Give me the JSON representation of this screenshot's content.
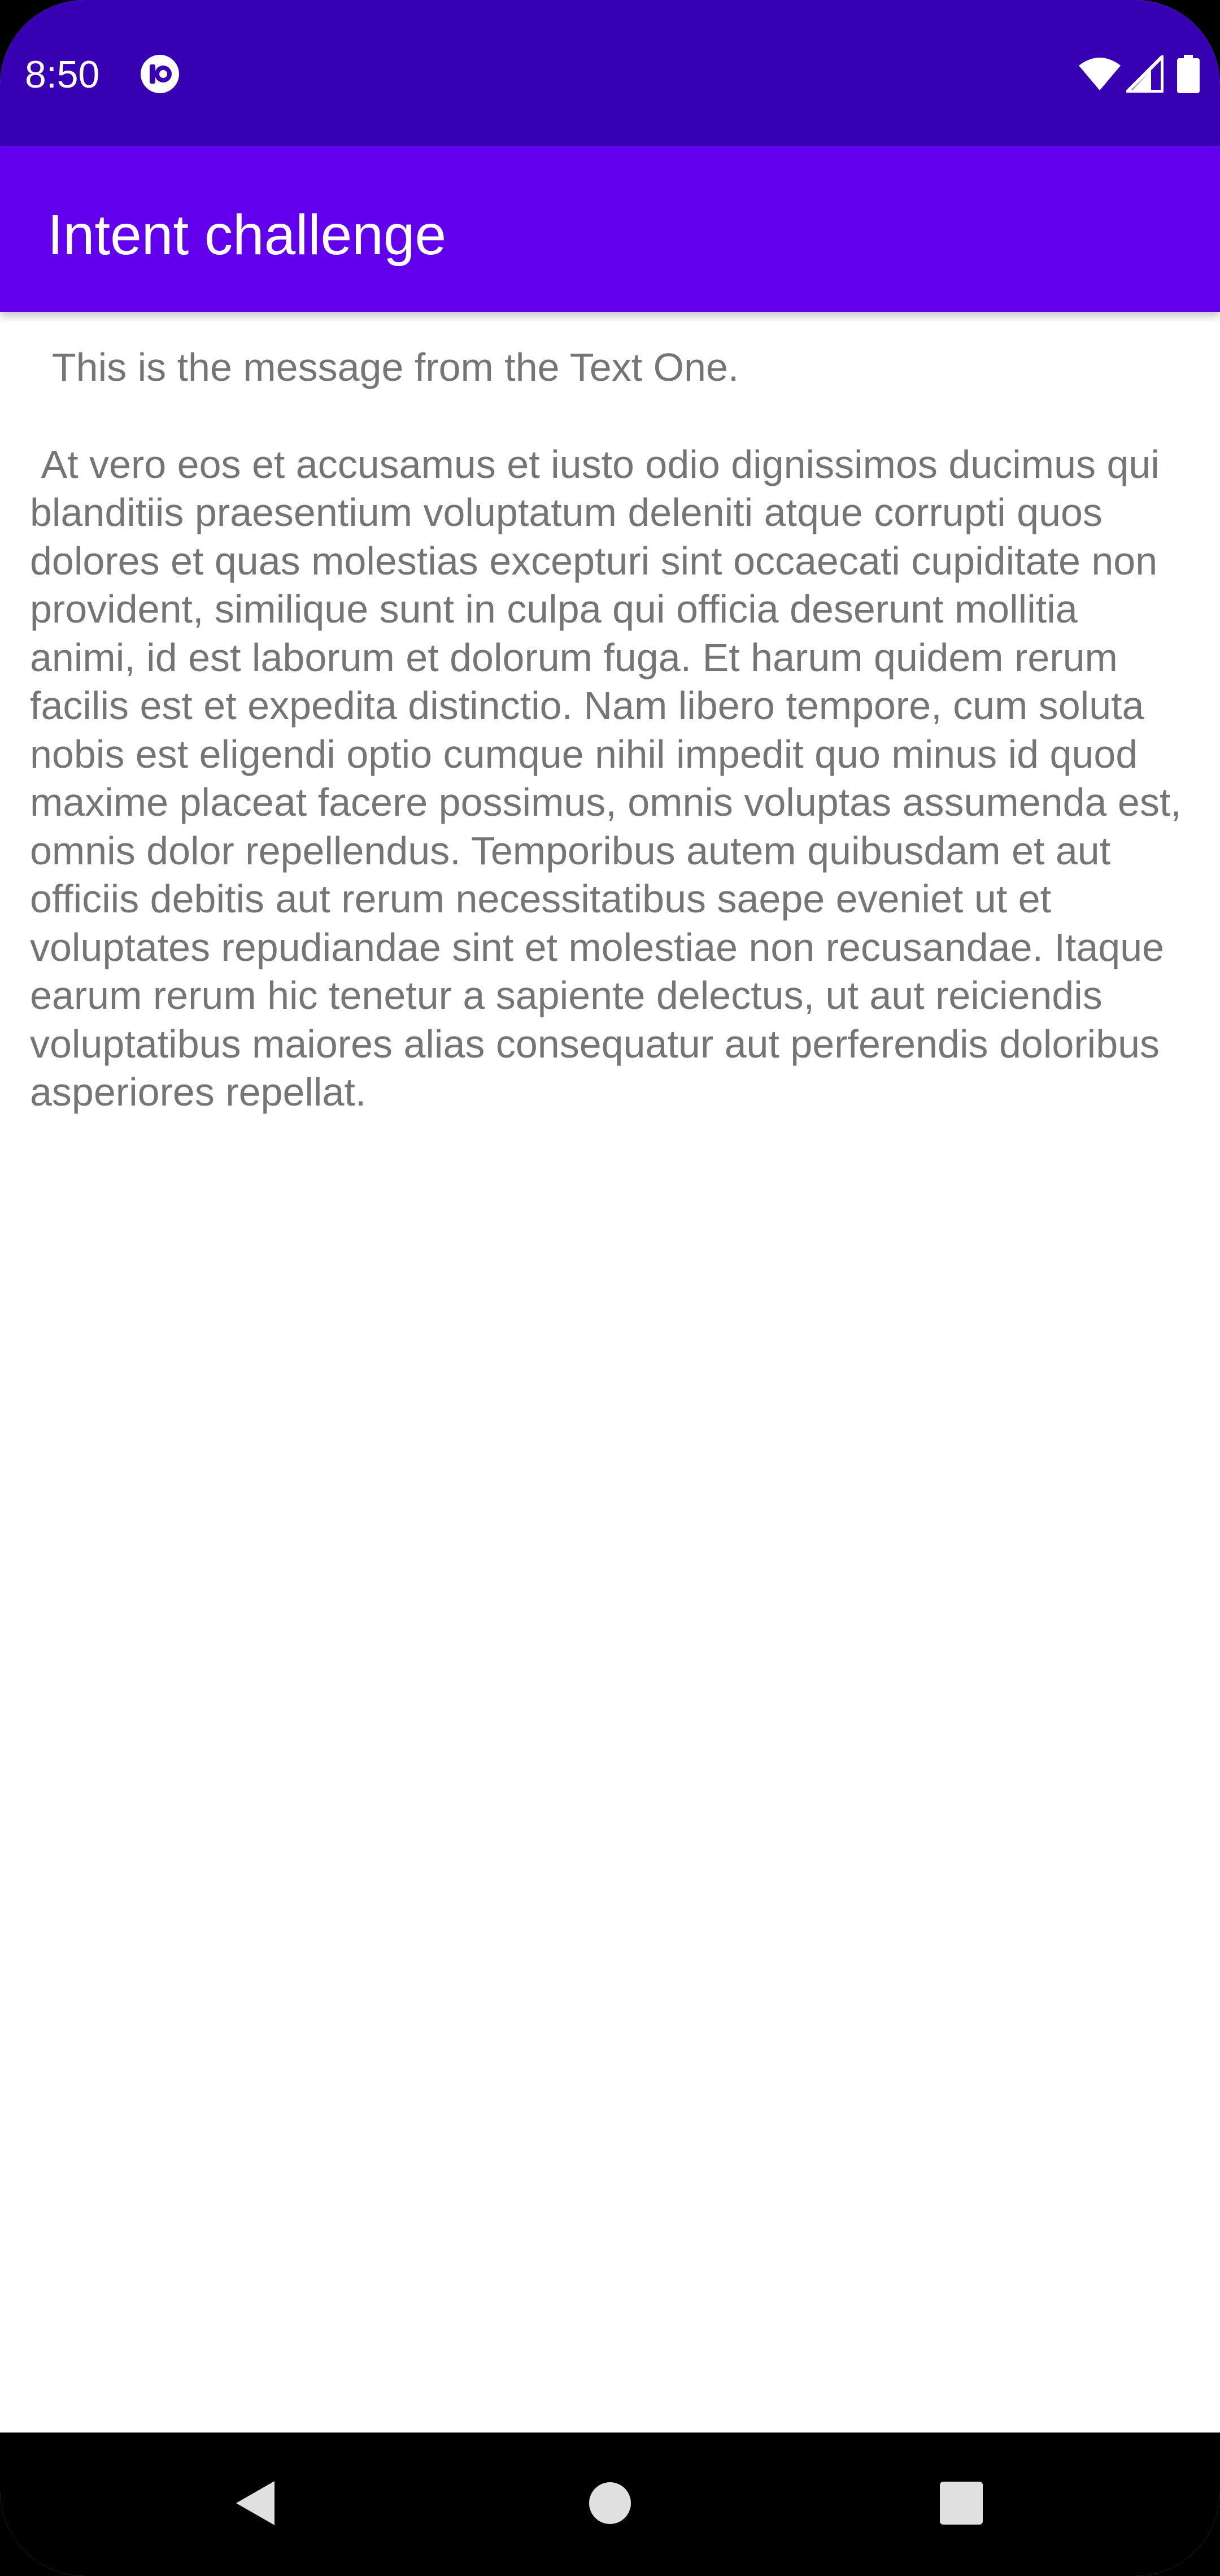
{
  "status_bar": {
    "time": "8:50",
    "app_icon": "notification-app-icon",
    "wifi_icon": "wifi-icon",
    "signal_icon": "cell-signal-icon",
    "battery_icon": "battery-icon"
  },
  "app_bar": {
    "title": "Intent challenge"
  },
  "content": {
    "message_one": "  This is the message from the Text One.",
    "body": " At vero eos et accusamus et iusto odio dignissimos ducimus qui blanditiis praesentium voluptatum deleniti atque corrupti quos dolores et quas molestias excepturi sint occaecati cupiditate non provident, similique sunt in culpa qui officia deserunt mollitia animi, id est laborum et dolorum fuga. Et harum quidem rerum facilis est et expedita distinctio. Nam libero tempore, cum soluta nobis est eligendi optio cumque nihil impedit quo minus id quod maxime placeat facere possimus, omnis voluptas assumenda est, omnis dolor repellendus. Temporibus autem quibusdam et aut officiis debitis aut rerum necessitatibus saepe eveniet ut et voluptates repudiandae sint et molestiae non recusandae. Itaque earum rerum hic tenetur a sapiente delectus, ut aut reiciendis voluptatibus maiores alias consequatur aut perferendis doloribus asperiores repellat."
  },
  "nav_bar": {
    "back_icon": "back-triangle-icon",
    "home_icon": "home-circle-icon",
    "recents_icon": "recents-square-icon"
  },
  "colors": {
    "status_bar": "#3700b3",
    "app_bar": "#6200ee",
    "text": "#757575",
    "nav_bar": "#000000"
  }
}
